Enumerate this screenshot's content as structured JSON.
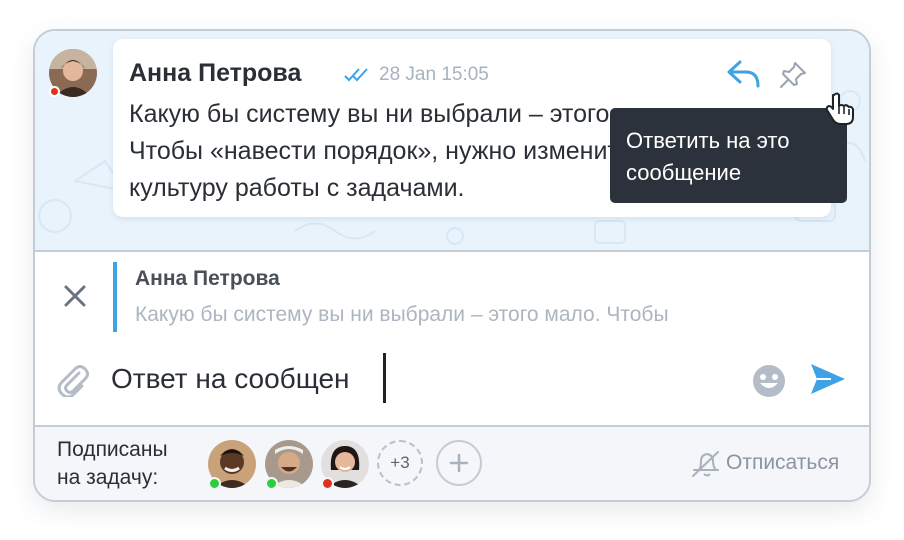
{
  "message": {
    "author": "Анна Петрова",
    "timestamp": "28 Jan 15:05",
    "lines": [
      "Какую бы систему вы ни выбрали – этого мало.",
      "Чтобы «навести порядок», нужно изменить",
      "культуру работы с задачами."
    ],
    "author_status_color": "#e0301e"
  },
  "tooltip": {
    "lines": [
      "Ответить на это",
      "сообщение"
    ]
  },
  "reply_preview": {
    "author": "Анна Петрова",
    "snippet": "Какую бы систему вы ни выбрали – этого мало. Чтобы"
  },
  "composer": {
    "value": "Ответ на сообщен"
  },
  "footer": {
    "subscribers_label_lines": [
      "Подписаны",
      "на задачу:"
    ],
    "more_count": "+3",
    "unsubscribe_label": "Отписаться",
    "subscriber_status_colors": [
      "#2ecc40",
      "#2ecc40",
      "#e0301e"
    ]
  },
  "icons": {
    "reply": "reply-arrow-icon",
    "pin": "pin-icon",
    "read": "double-check-icon",
    "close": "close-icon",
    "attach": "paperclip-icon",
    "emoji": "smiley-icon",
    "send": "send-icon",
    "add": "plus-icon",
    "unsubscribe": "bell-slash-icon"
  },
  "colors": {
    "accent": "#3ea2e5",
    "chat_background": "#e9f3fc",
    "tooltip_background": "#2c323b"
  }
}
